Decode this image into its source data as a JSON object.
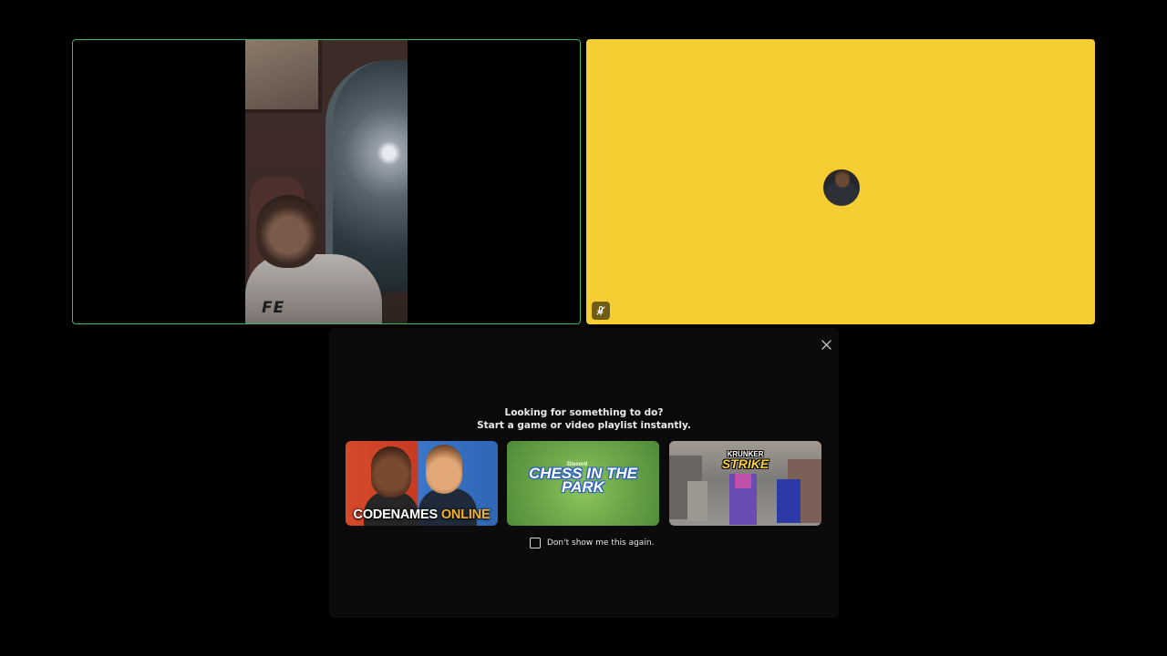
{
  "tiles": {
    "camera": {
      "shirt_text": "FE",
      "speaking": true,
      "speaking_color": "#3bb56a"
    },
    "avatar": {
      "background_color": "#f4ce33",
      "muted": true,
      "mute_icon": "mic-off-icon"
    }
  },
  "activity_prompt": {
    "close_icon": "close-icon",
    "line1": "Looking for something to do?",
    "line2": "Start a game or video playlist instantly.",
    "activities": [
      {
        "title_main": "CODENAMES ",
        "title_accent": "ONLINE"
      },
      {
        "badge": "Discord",
        "title": "CHESS IN THE PARK"
      },
      {
        "title_line1": "KRUNKER",
        "title_line2": "STRIKE"
      }
    ],
    "dont_show_label": "Don't show me this again.",
    "dont_show_checked": false
  }
}
